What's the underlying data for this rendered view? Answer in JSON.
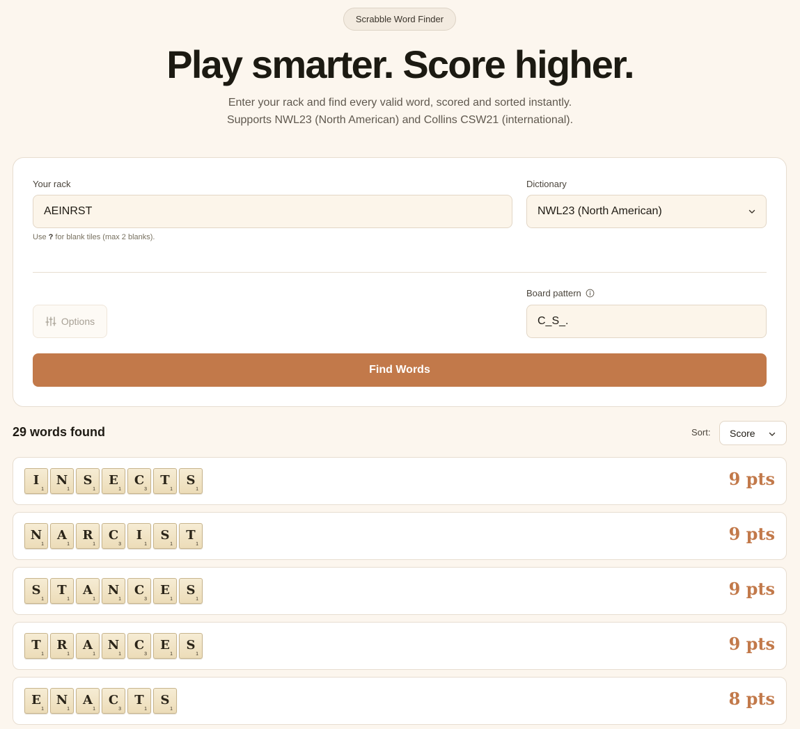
{
  "header": {
    "badge": "Scrabble Word Finder",
    "title": "Play smarter. Score higher.",
    "subtitle_line1": "Enter your rack and find every valid word, scored and sorted instantly.",
    "subtitle_line2": "Supports NWL23 (North American) and Collins CSW21 (international)."
  },
  "form": {
    "rack_label": "Your rack",
    "rack_value": "AEINRST",
    "rack_hint_prefix": "Use",
    "rack_hint_key": "?",
    "rack_hint_suffix": "for blank tiles (max 2 blanks).",
    "dictionary_label": "Dictionary",
    "dictionary_value": "NWL23 (North American)",
    "board_pattern_label": "Board pattern",
    "board_pattern_value": "C_S_.",
    "options_label": "Options",
    "find_button": "Find Words"
  },
  "results": {
    "count_text": "29 words found",
    "sort_label": "Sort:",
    "sort_value": "Score",
    "words": [
      {
        "tiles": [
          [
            "I",
            "1"
          ],
          [
            "N",
            "1"
          ],
          [
            "S",
            "1"
          ],
          [
            "E",
            "1"
          ],
          [
            "C",
            "3"
          ],
          [
            "T",
            "1"
          ],
          [
            "S",
            "1"
          ]
        ],
        "score": "9 pts"
      },
      {
        "tiles": [
          [
            "N",
            "1"
          ],
          [
            "A",
            "1"
          ],
          [
            "R",
            "1"
          ],
          [
            "C",
            "3"
          ],
          [
            "I",
            "1"
          ],
          [
            "S",
            "1"
          ],
          [
            "T",
            "1"
          ]
        ],
        "score": "9 pts"
      },
      {
        "tiles": [
          [
            "S",
            "1"
          ],
          [
            "T",
            "1"
          ],
          [
            "A",
            "1"
          ],
          [
            "N",
            "1"
          ],
          [
            "C",
            "3"
          ],
          [
            "E",
            "1"
          ],
          [
            "S",
            "1"
          ]
        ],
        "score": "9 pts"
      },
      {
        "tiles": [
          [
            "T",
            "1"
          ],
          [
            "R",
            "1"
          ],
          [
            "A",
            "1"
          ],
          [
            "N",
            "1"
          ],
          [
            "C",
            "3"
          ],
          [
            "E",
            "1"
          ],
          [
            "S",
            "1"
          ]
        ],
        "score": "9 pts"
      },
      {
        "tiles": [
          [
            "E",
            "1"
          ],
          [
            "N",
            "1"
          ],
          [
            "A",
            "1"
          ],
          [
            "C",
            "3"
          ],
          [
            "T",
            "1"
          ],
          [
            "S",
            "1"
          ]
        ],
        "score": "8 pts"
      }
    ]
  },
  "colors": {
    "background": "#fcf6ee",
    "accent": "#c2794a",
    "tile": "#f1e4c6"
  }
}
